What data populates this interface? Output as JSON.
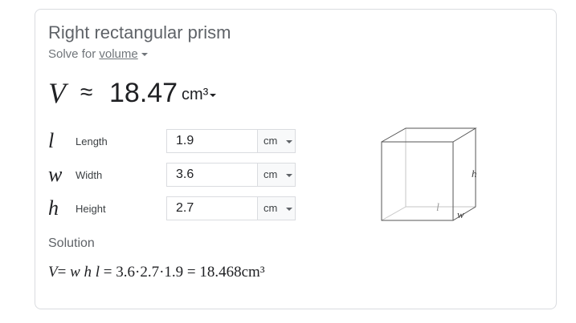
{
  "calculator": {
    "title": "Right rectangular prism",
    "solve_for_prefix": "Solve for ",
    "solve_for_value": "volume",
    "result": {
      "symbol": "V",
      "approx": "≈",
      "value": "18.47",
      "unit": "cm³"
    },
    "inputs": [
      {
        "symbol": "l",
        "label": "Length",
        "value": "1.9",
        "unit": "cm"
      },
      {
        "symbol": "w",
        "label": "Width",
        "value": "3.6",
        "unit": "cm"
      },
      {
        "symbol": "h",
        "label": "Height",
        "value": "2.7",
        "unit": "cm"
      }
    ],
    "solution_label": "Solution",
    "formula": {
      "lhs": "V",
      "eq1": "= ",
      "vars": "w h l",
      "rhs": " = 3.6·2.7·1.9 = 18.468cm³"
    },
    "diagram_labels": {
      "h": "h",
      "l": "l",
      "w": "w"
    }
  }
}
